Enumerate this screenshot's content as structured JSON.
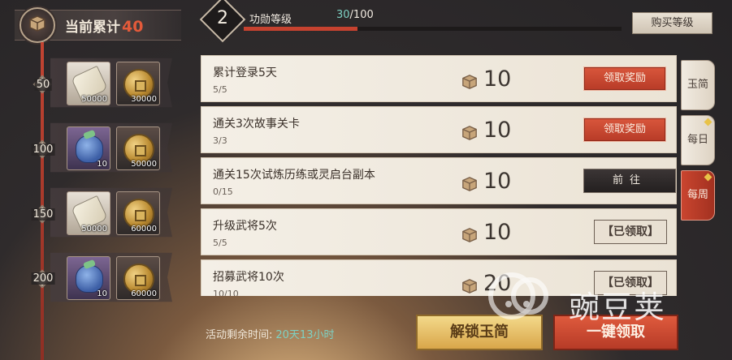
{
  "accumulated": {
    "label": "当前累计",
    "value": "40"
  },
  "header": {
    "level": "2",
    "title": "功勋等级",
    "progress_current": "30",
    "progress_max": "/100",
    "progress_fraction": 0.3,
    "buy_level_label": "购买等级"
  },
  "track": {
    "levels": [
      {
        "level": "50",
        "rewards": [
          {
            "icon": "scroll-icon",
            "count": "50000"
          },
          {
            "icon": "coin-icon",
            "count": "30000"
          }
        ]
      },
      {
        "level": "100",
        "rewards": [
          {
            "icon": "bag-icon",
            "count": "10"
          },
          {
            "icon": "coin-icon",
            "count": "50000"
          }
        ]
      },
      {
        "level": "150",
        "rewards": [
          {
            "icon": "scroll-icon",
            "count": "50000"
          },
          {
            "icon": "coin-icon",
            "count": "60000"
          }
        ]
      },
      {
        "level": "200",
        "rewards": [
          {
            "icon": "bag-icon",
            "count": "10"
          },
          {
            "icon": "coin-icon",
            "count": "60000"
          }
        ]
      }
    ]
  },
  "tasks": [
    {
      "title": "累计登录5天",
      "progress": "5/5",
      "reward": "10",
      "state": "claim",
      "action_label": "领取奖励"
    },
    {
      "title": "通关3次故事关卡",
      "progress": "3/3",
      "reward": "10",
      "state": "claim",
      "action_label": "领取奖励"
    },
    {
      "title": "通关15次试炼历练或灵启台副本",
      "progress": "0/15",
      "reward": "10",
      "state": "goto",
      "action_label": "前往"
    },
    {
      "title": "升级武将5次",
      "progress": "5/5",
      "reward": "10",
      "state": "claimed",
      "action_label": "【已领取】"
    },
    {
      "title": "招募武将10次",
      "progress": "10/10",
      "reward": "20",
      "state": "claimed",
      "action_label": "【已领取】"
    }
  ],
  "side_tabs": [
    {
      "label": "玉简",
      "active": false
    },
    {
      "label": "每日",
      "active": false
    },
    {
      "label": "每周",
      "active": true
    }
  ],
  "footer": {
    "remaining_label": "活动剩余时间:",
    "remaining_value": "20天13小时",
    "unlock_label": "解锁玉简",
    "claim_all_label": "一键领取"
  },
  "watermark": {
    "text": "豌豆荚"
  },
  "colors": {
    "accent_red": "#c6422f",
    "accent_teal": "#7ed1c3",
    "gold": "#d9a64a"
  }
}
